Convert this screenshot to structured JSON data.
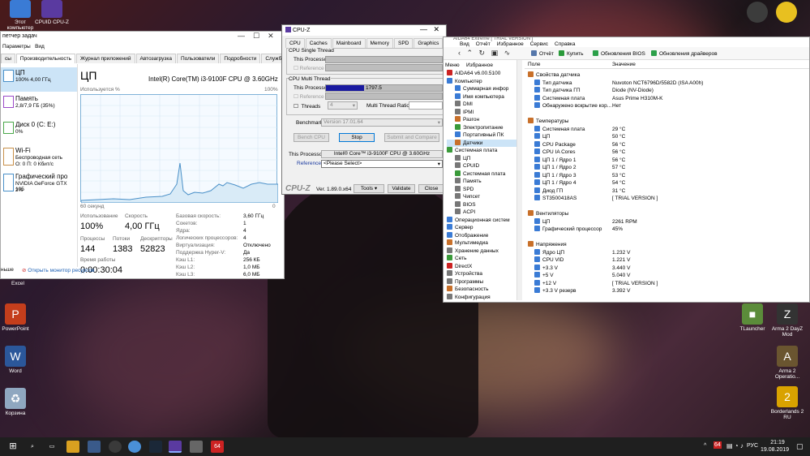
{
  "desktop": {
    "left_icons": [
      {
        "label": "PowerPoint",
        "color": "#c43e1c",
        "glyph": "P"
      },
      {
        "label": "Word",
        "color": "#2b579a",
        "glyph": "W"
      },
      {
        "label": "Корзина",
        "color": "#8fa7c0",
        "glyph": "♻"
      }
    ],
    "right_icons": [
      {
        "label": "TLauncher",
        "color": "#5b8c3a",
        "glyph": "■"
      },
      {
        "label": "Arma 2 DayZ Mod",
        "color": "#333",
        "glyph": "Z"
      },
      {
        "label": "Arma 2 Operatio...",
        "color": "#6a5530",
        "glyph": "A"
      },
      {
        "label": "Borderlands 2 RU",
        "color": "#d9a200",
        "glyph": "2"
      }
    ],
    "top_icons": [
      {
        "label": "Этот компьютер"
      },
      {
        "label": "CPUID CPU-Z"
      }
    ],
    "excel_label": "Excel"
  },
  "taskmgr": {
    "title": "петчер задач",
    "menu": [
      "Параметры",
      "Вид"
    ],
    "tabs": [
      "сы",
      "Производительность",
      "Журнал приложений",
      "Автозагрузка",
      "Пользователи",
      "Подробности",
      "Службы"
    ],
    "side": [
      {
        "name": "ЦП",
        "sub": "100%  4,00 ГГц"
      },
      {
        "name": "Память",
        "sub": "2,8/7,9 ГБ (35%)"
      },
      {
        "name": "Диск 0 (C: E:)",
        "sub": "0%"
      },
      {
        "name": "Wi-Fi",
        "sub": "Беспроводная сеть",
        "sub2": "О: 0  П: 0 Кбит/с"
      },
      {
        "name": "Графический про",
        "sub": "NVIDIA GeForce GTX 105",
        "sub2": "2%"
      }
    ],
    "header": "ЦП",
    "cpu_name": "Intel(R) Core(TM) i3-9100F CPU @ 3.60GHz",
    "graph_label": "Используется %",
    "graph_max": "100%",
    "graph_time": "60 секунд",
    "graph_min": "0",
    "stats": {
      "util_label": "Использование",
      "util": "100%",
      "speed_label": "Скорость",
      "speed": "4,00 ГГц",
      "proc_label": "Процессы",
      "proc": "144",
      "thr_label": "Потоки",
      "thr": "1383",
      "desc_label": "Дескрипторы",
      "desc": "52823",
      "up_label": "Время работы",
      "up": "0:00:30:04"
    },
    "details": [
      [
        "Базовая скорость:",
        "3,60 ГГц"
      ],
      [
        "Сокетов:",
        "1"
      ],
      [
        "Ядра:",
        "4"
      ],
      [
        "Логических процессоров:",
        "4"
      ],
      [
        "Виртуализация:",
        "Отключено"
      ],
      [
        "Поддержка Hyper-V:",
        "Да"
      ],
      [
        "Кэш L1:",
        "256 КБ"
      ],
      [
        "Кэш L2:",
        "1,0 МБ"
      ],
      [
        "Кэш L3:",
        "6,0 МБ"
      ]
    ],
    "footer_less": "ньше",
    "footer_link": "Открыть монитор ресурсов"
  },
  "cpuz": {
    "title": "CPU-Z",
    "tabs": [
      "CPU",
      "Caches",
      "Mainboard",
      "Memory",
      "SPD",
      "Graphics",
      "Bench",
      "About"
    ],
    "single_title": "CPU Single Thread",
    "multi_title": "CPU Multi Thread",
    "this_proc": "This Processor",
    "reference": "Reference",
    "multi_value": "1797.5",
    "multi_fill": 0.33,
    "threads_label": "Threads",
    "threads": "4",
    "mtr_label": "Multi Thread Ratio",
    "bench_label": "Benchmark",
    "bench_ver": "Version 17.01.64",
    "btn_bench": "Bench CPU",
    "btn_stop": "Stop",
    "btn_submit": "Submit and Compare",
    "proc_label": "This Processor",
    "proc_val": "Intel® Core™ i3-9100F CPU @ 3.60GHz",
    "ref_label": "Reference",
    "ref_val": "<Please Select>",
    "logo": "CPU-Z",
    "ver": "Ver. 1.89.0.x64",
    "btn_tools": "Tools",
    "btn_validate": "Validate",
    "btn_close": "Close"
  },
  "aida": {
    "title": "AIDA64 Extreme  [ TRIAL VERSION ]",
    "menu": [
      "Вид",
      "Отчёт",
      "Избранное",
      "Сервис",
      "Справка"
    ],
    "toolbar": [
      "Отчёт",
      "Купить",
      "Обновления BIOS",
      "Обновления драйверов"
    ],
    "side_tabs": [
      "Меню",
      "Избранное"
    ],
    "tree": [
      "AIDA64 v6.00.5100",
      "Компьютер",
      "Суммарная инфор",
      "Имя компьютера",
      "DMI",
      "IPMI",
      "Разгон",
      "Электропитание",
      "Портативный ПК",
      "Датчики",
      "Системная плата",
      "ЦП",
      "CPUID",
      "Системная плата",
      "Память",
      "SPD",
      "Чипсет",
      "BIOS",
      "ACPI",
      "Операционная систем",
      "Сервер",
      "Отображение",
      "Мультимедиа",
      "Хранение данных",
      "Сеть",
      "DirectX",
      "Устройства",
      "Программы",
      "Безопасность",
      "Конфигурация"
    ],
    "col_field": "Поле",
    "col_value": "Значение",
    "rows": [
      {
        "f": "Свойства датчика",
        "v": "",
        "h": true
      },
      {
        "f": "Тип датчика",
        "v": "Nuvoton NCT6796D/5582D  (ISA A00h)"
      },
      {
        "f": "Тип датчика ГП",
        "v": "Diode  (NV-Diode)"
      },
      {
        "f": "Системная плата",
        "v": "Asus Prime H310M-K"
      },
      {
        "f": "Обнаружено вскрытие кор...",
        "v": "Нет"
      },
      {
        "f": "",
        "v": ""
      },
      {
        "f": "Температуры",
        "v": "",
        "h": true
      },
      {
        "f": "Системная плата",
        "v": "29 °C"
      },
      {
        "f": "ЦП",
        "v": "50 °C"
      },
      {
        "f": "CPU Package",
        "v": "56 °C"
      },
      {
        "f": "CPU IA Cores",
        "v": "56 °C"
      },
      {
        "f": "ЦП 1 / Ядро 1",
        "v": "56 °C"
      },
      {
        "f": "ЦП 1 / Ядро 2",
        "v": "57 °C"
      },
      {
        "f": "ЦП 1 / Ядро 3",
        "v": "53 °C"
      },
      {
        "f": "ЦП 1 / Ядро 4",
        "v": "54 °C"
      },
      {
        "f": "Диод ГП",
        "v": "31 °C"
      },
      {
        "f": "ST3500418AS",
        "v": "[ TRIAL VERSION ]"
      },
      {
        "f": "",
        "v": ""
      },
      {
        "f": "Вентиляторы",
        "v": "",
        "h": true
      },
      {
        "f": "ЦП",
        "v": "2261 RPM"
      },
      {
        "f": "Графический процессор",
        "v": "45%"
      },
      {
        "f": "",
        "v": ""
      },
      {
        "f": "Напряжения",
        "v": "",
        "h": true
      },
      {
        "f": "Ядро ЦП",
        "v": "1.232 V"
      },
      {
        "f": "CPU VID",
        "v": "1.221 V"
      },
      {
        "f": "+3.3 V",
        "v": "3.440 V"
      },
      {
        "f": "+5 V",
        "v": "5.040 V"
      },
      {
        "f": "+12 V",
        "v": "[ TRIAL VERSION ]"
      },
      {
        "f": "+3.3 V резерв",
        "v": "3.392 V"
      }
    ]
  },
  "taskbar": {
    "tray_num": "64",
    "lang": "РУС",
    "time": "21:19",
    "date": "19.08.2019",
    "pin_num": "64"
  }
}
